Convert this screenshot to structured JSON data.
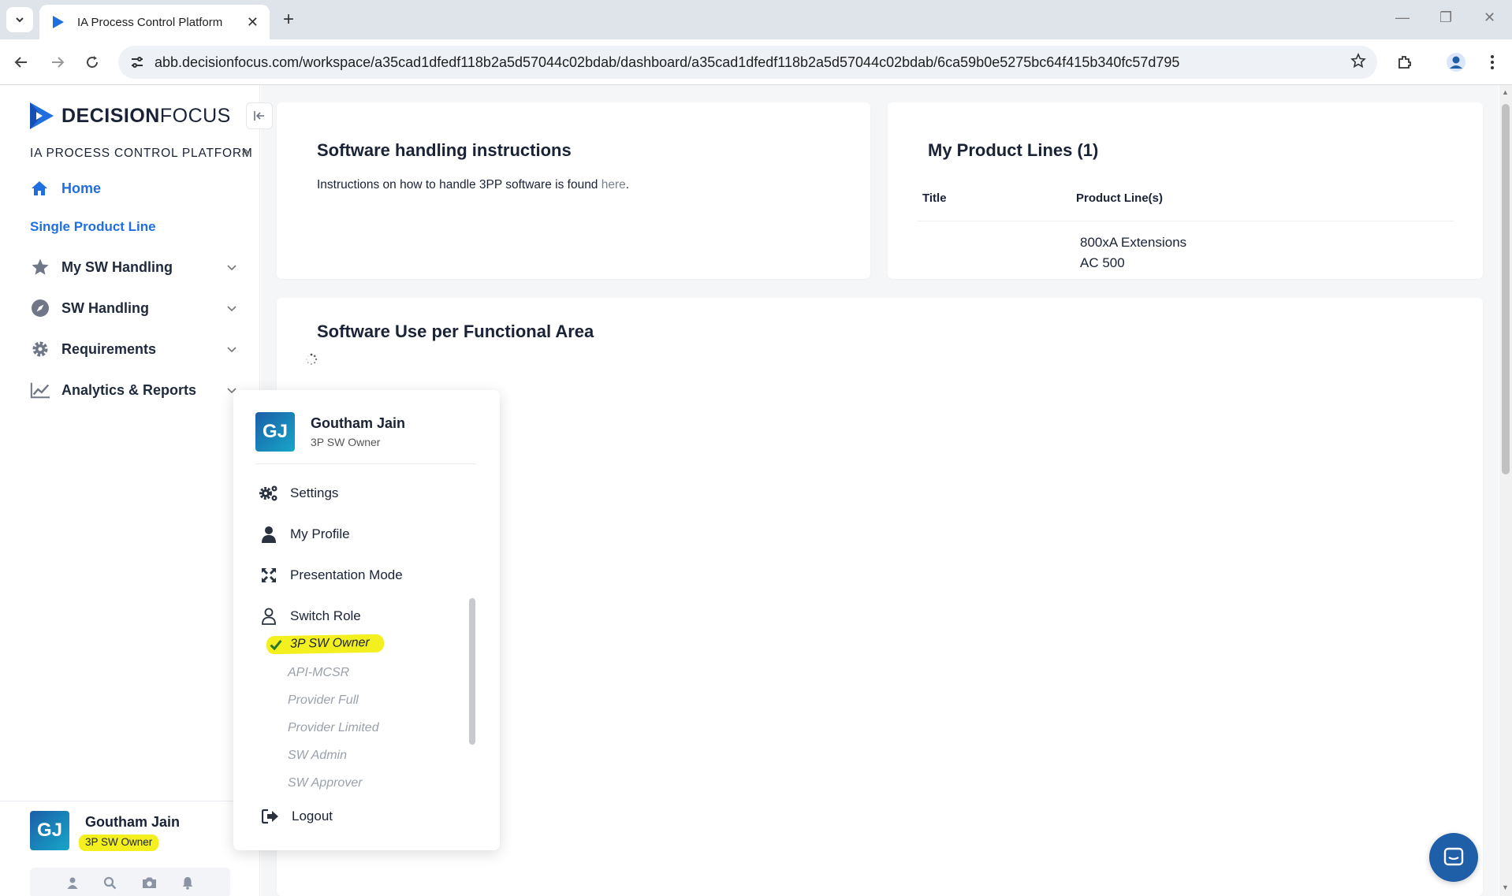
{
  "browser": {
    "tab_title": "IA Process Control Platform",
    "url": "abb.decisionfocus.com/workspace/a35cad1dfedf118b2a5d57044c02bdab/dashboard/a35cad1dfedf118b2a5d57044c02bdab/6ca59b0e5275bc64f415b340fc57d795"
  },
  "logo": {
    "bold": "DECISION",
    "light": "FOCUS"
  },
  "sidebar": {
    "platform_label": "IA PROCESS CONTROL PLATFORM",
    "home": "Home",
    "single_product_line": "Single Product Line",
    "items": [
      {
        "label": "My SW Handling",
        "icon": "star-icon"
      },
      {
        "label": "SW Handling",
        "icon": "compass-icon"
      },
      {
        "label": "Requirements",
        "icon": "gear-icon"
      },
      {
        "label": "Analytics & Reports",
        "icon": "chart-line-icon"
      }
    ],
    "user": {
      "initials": "GJ",
      "name": "Goutham Jain",
      "role": "3P SW Owner"
    }
  },
  "cards": {
    "instructions": {
      "title": "Software handling instructions",
      "text": "Instructions on how to handle 3PP software is found ",
      "link": "here",
      "suffix": "."
    },
    "product_lines": {
      "title": "My Product Lines (1)",
      "col_title": "Title",
      "col_product_lines": "Product Line(s)",
      "values": [
        "800xA Extensions",
        "AC 500"
      ]
    },
    "functional_area": {
      "title": "Software Use per Functional Area"
    }
  },
  "menu": {
    "initials": "GJ",
    "name": "Goutham Jain",
    "role": "3P SW Owner",
    "settings": "Settings",
    "profile": "My Profile",
    "presentation": "Presentation Mode",
    "switch_role": "Switch Role",
    "active_role": "3P SW Owner",
    "roles": [
      "API-MCSR",
      "Provider Full",
      "Provider Limited",
      "SW Admin",
      "SW Approver"
    ],
    "logout": "Logout"
  },
  "colors": {
    "accent": "#1f6fe0",
    "highlight": "#f4ef1e",
    "brand_dark": "#1b5fa8"
  }
}
